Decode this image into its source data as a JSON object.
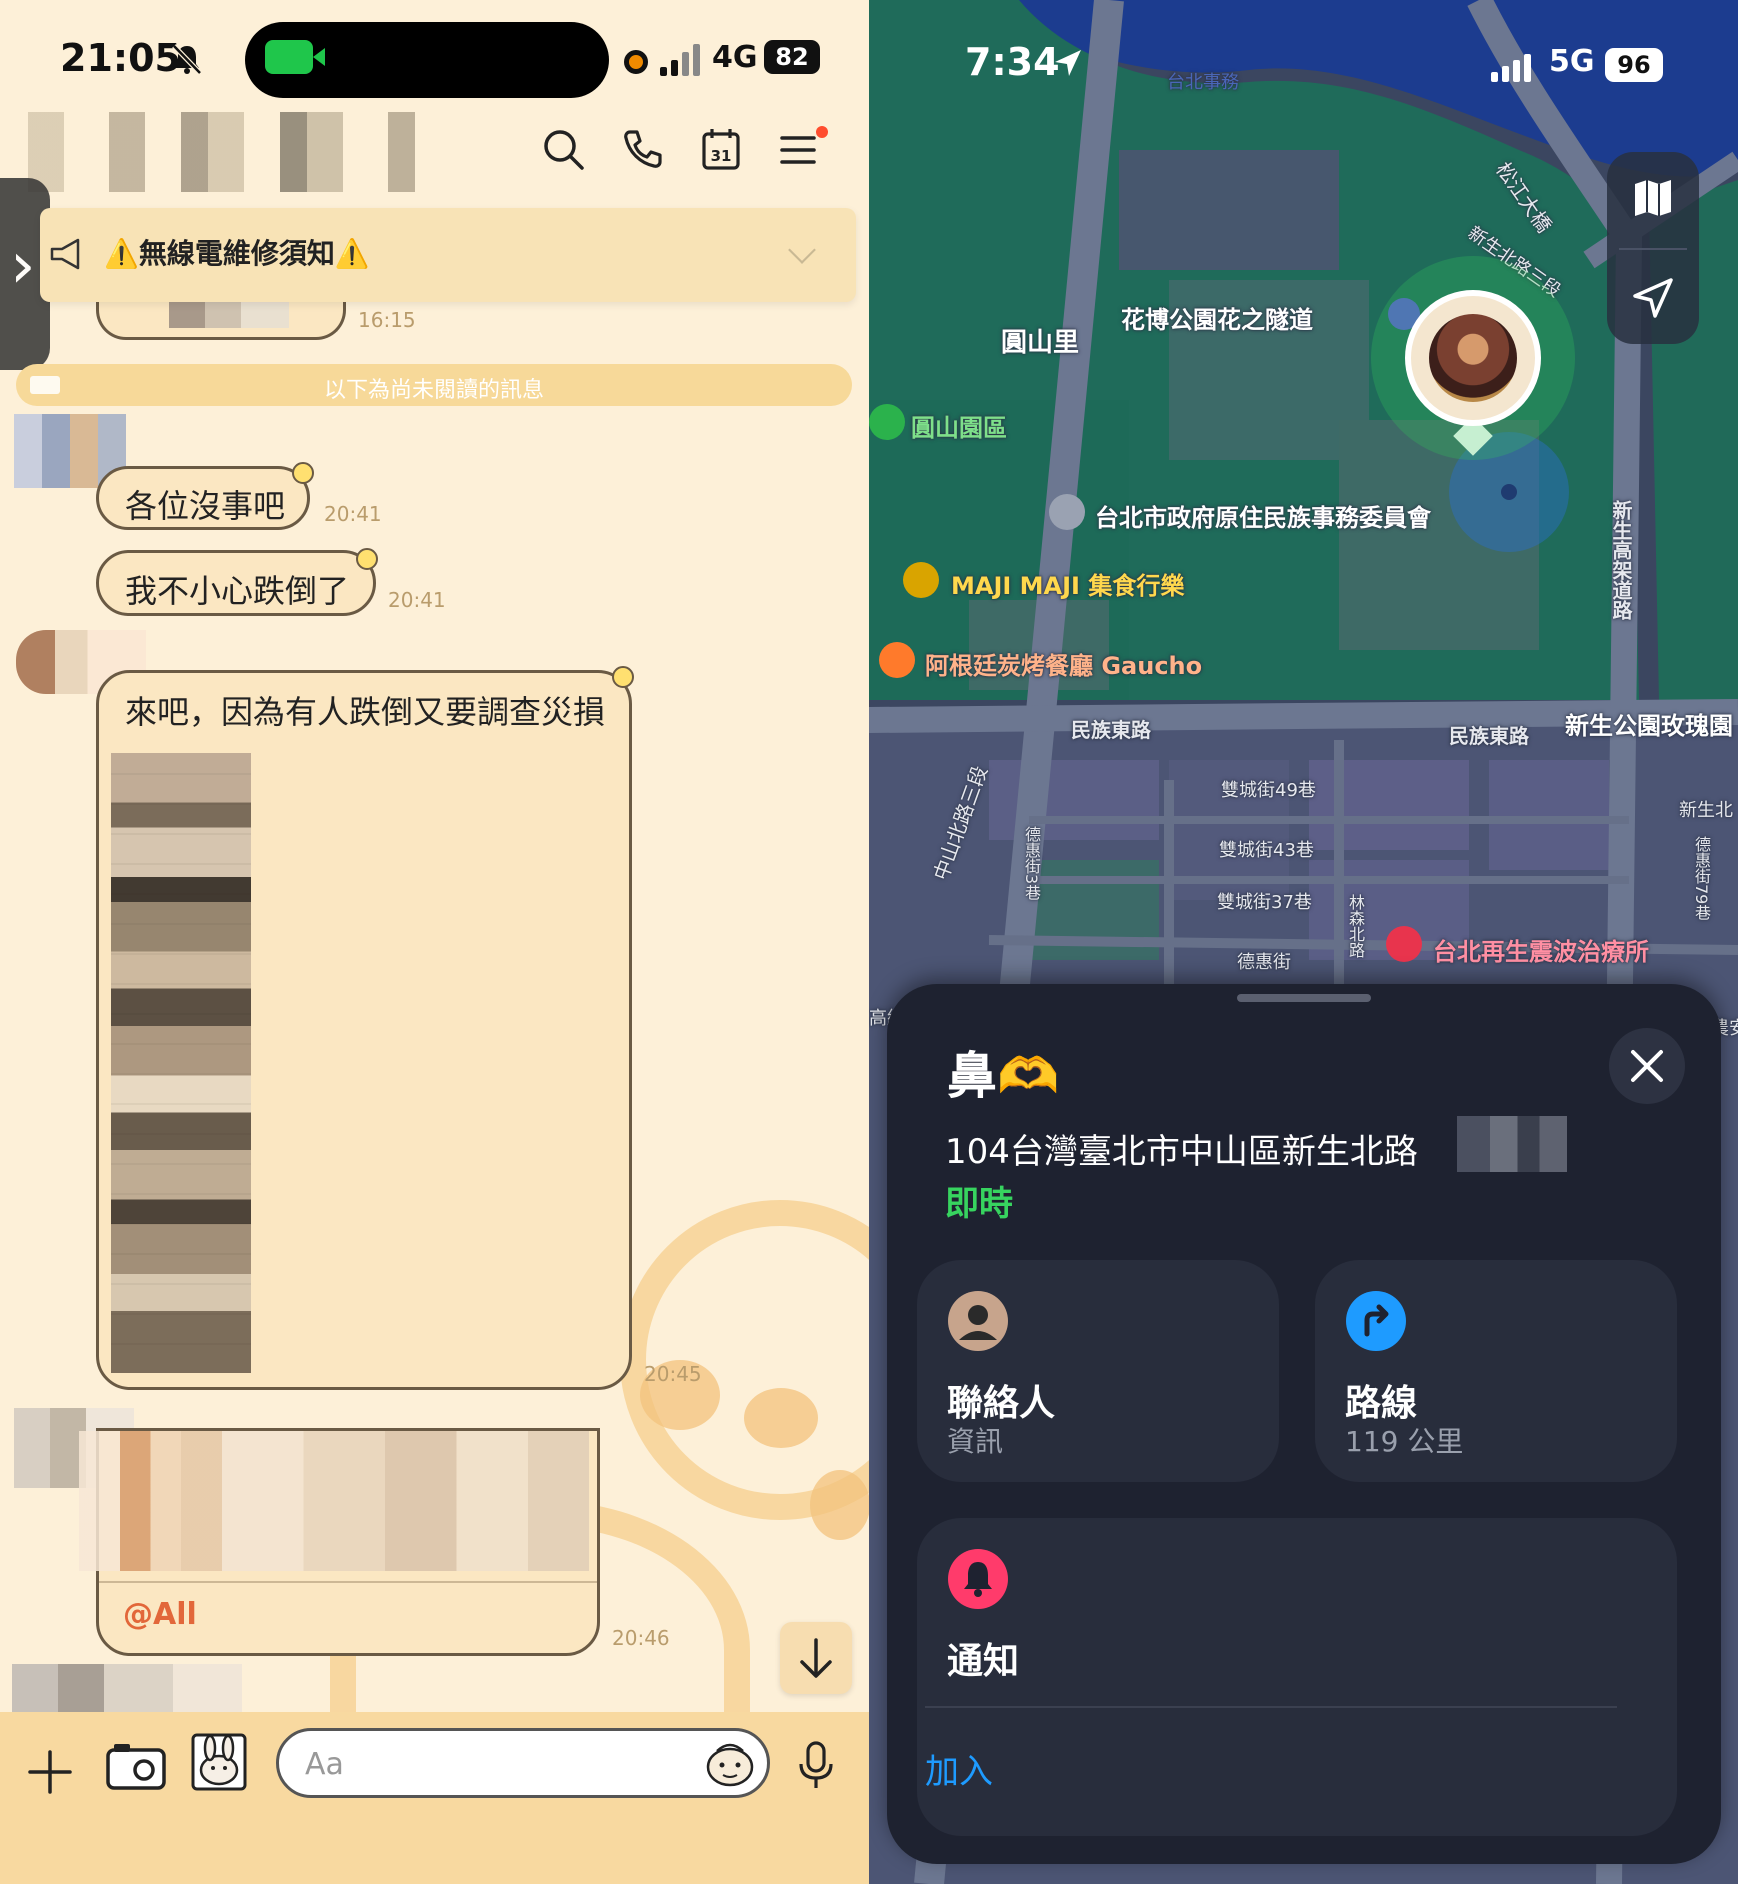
{
  "left": {
    "status": {
      "time": "21:05",
      "network": "4G",
      "battery": "82"
    },
    "header": {
      "icons": [
        "search-icon",
        "phone-icon",
        "calendar-icon",
        "menu-icon"
      ],
      "calendar_day": "31"
    },
    "announcement": {
      "text": "⚠️無線電維修須知⚠️"
    },
    "messages": {
      "partial_ts": "16:15",
      "unread_divider": "以下為尚未閱讀的訊息",
      "m1": {
        "text": "各位沒事吧",
        "time": "20:41"
      },
      "m2": {
        "text": "我不小心跌倒了",
        "time": "20:41"
      },
      "m3": {
        "text": "來吧，因為有人跌倒又要調查災損",
        "time": "20:45"
      },
      "m4": {
        "mention": "@All",
        "time": "20:46"
      }
    },
    "input": {
      "placeholder": "Aa"
    },
    "colors": {
      "background": "#fdf0d8",
      "bubble": "#fbe7c2",
      "bubble_border": "#6a5a44",
      "mention": "#e2673a"
    }
  },
  "right": {
    "status": {
      "time": "7:34",
      "network": "5G",
      "battery": "96"
    },
    "map_labels": {
      "yuanshan_li": "圓山里",
      "tunnel": "花博公園花之隧道",
      "yuanshan_park": "圓山園區",
      "council": "台北市政府原住民族事務委員會",
      "maji": "MAJI MAJI 集食行樂",
      "gaucho": "阿根廷炭烤餐廳 Gaucho",
      "minzu_e1": "民族東路",
      "minzu_e2": "民族東路",
      "rose_garden": "新生公園玫瑰園",
      "shuangcheng49": "雙城街49巷",
      "shuangcheng43": "雙城街43巷",
      "shuangcheng37": "雙城街37巷",
      "dehui": "德惠街",
      "clinic": "台北再生震波治療所",
      "songjiang_bridge": "松江大橋",
      "xinsheng_n3": "新生北路三段",
      "xinsheng_n3b": "新生北路三段",
      "xinsheng_elevated": "新生高架道路",
      "zhongshan_n3": "中山北路三段",
      "linsen_n": "林森北路",
      "dehui_3": "德惠街3巷",
      "dehui_79": "德惠街79巷",
      "xinsheng_n": "新生北",
      "taipei_affairs": "台北事務",
      "high_edge": "高級",
      "farm_edge": "農安"
    },
    "sheet": {
      "name": "鼻🫶",
      "address": "104台灣臺北市中山區新生北路",
      "live": "即時",
      "contact": {
        "title": "聯絡人",
        "subtitle": "資訊"
      },
      "directions": {
        "title": "路線",
        "subtitle": "119 公里"
      },
      "notifications": {
        "title": "通知",
        "action": "加入"
      }
    },
    "colors": {
      "sheet": "#1e2230",
      "live": "#37d45f",
      "link": "#1e9bff",
      "directions": "#1e9bff",
      "notify": "#ff3b6b"
    }
  }
}
